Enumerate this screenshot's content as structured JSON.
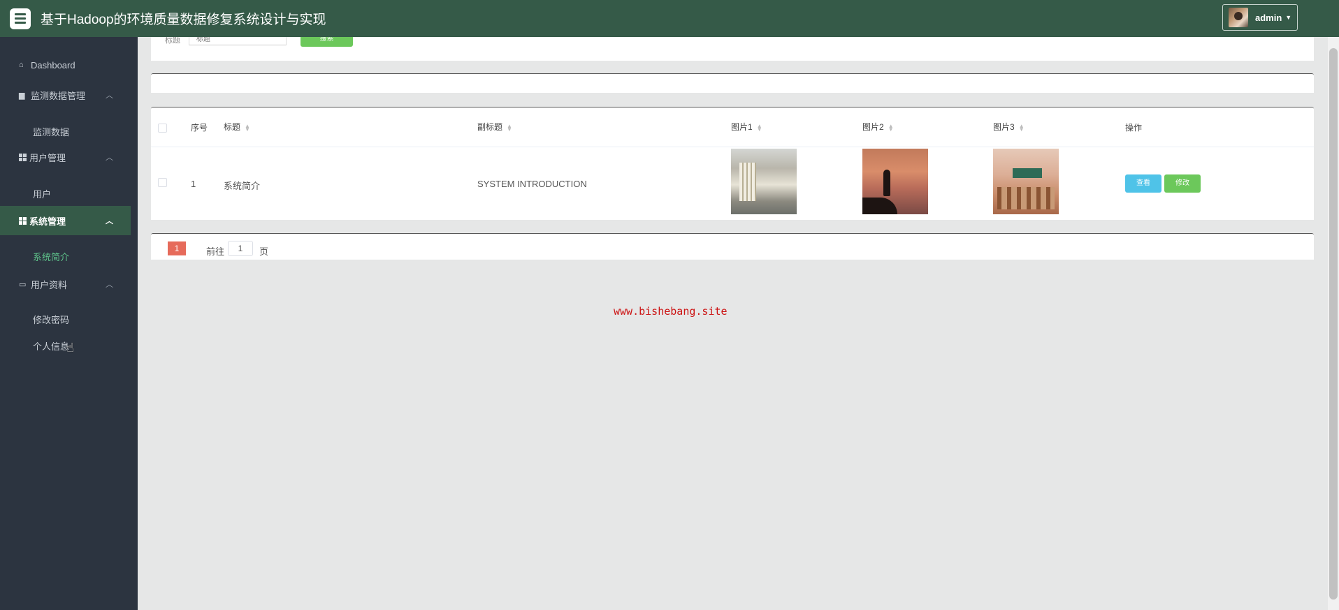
{
  "header": {
    "title": "基于Hadoop的环境质量数据修复系统设计与实现",
    "user": "admin"
  },
  "sidebar": {
    "dashboard": "Dashboard",
    "groups": [
      {
        "label": "监测数据管理",
        "icon": "message-icon",
        "sub": [
          "监测数据"
        ]
      },
      {
        "label": "用户管理",
        "icon": "grid-icon",
        "sub": [
          "用户"
        ]
      },
      {
        "label": "系统管理",
        "icon": "grid-icon",
        "sub": [
          "系统简介"
        ],
        "active": true
      },
      {
        "label": "用户资料",
        "icon": "card-icon",
        "sub": [
          "修改密码",
          "个人信息"
        ]
      }
    ]
  },
  "search": {
    "label": "标题",
    "placeholder": "标题",
    "button": "搜索"
  },
  "table": {
    "headers": {
      "index": "序号",
      "title": "标题",
      "subtitle": "副标题",
      "pic1": "图片1",
      "pic2": "图片2",
      "pic3": "图片3",
      "ops": "操作"
    },
    "rows": [
      {
        "index": "1",
        "title": "系统简介",
        "subtitle": "SYSTEM INTRODUCTION",
        "view": "查看",
        "edit": "修改"
      }
    ]
  },
  "pager": {
    "current": "1",
    "goto_label": "前往",
    "goto_value": "1",
    "goto_suffix": "页"
  },
  "watermark": "www.bishebang.site",
  "colors": {
    "header": "#355a48",
    "sidebar": "#2c3440",
    "active_sub": "#5fc58b",
    "view_button": "#4fc3e8",
    "edit_button": "#6cc85b",
    "page_current": "#e66b5b",
    "watermark": "#cc1414"
  }
}
